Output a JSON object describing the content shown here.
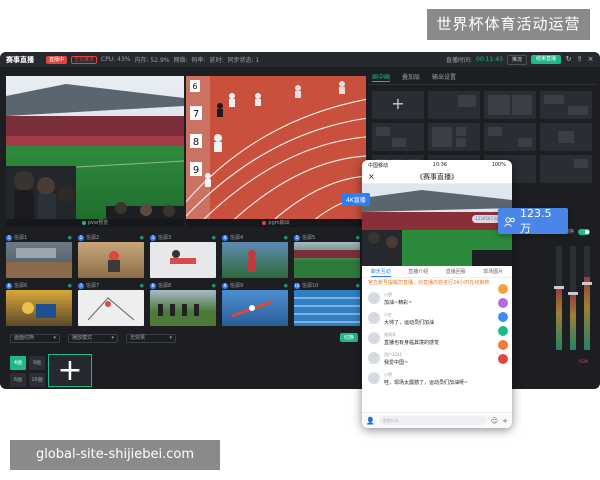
{
  "overlay": {
    "top_banner": "世界杯体育活动运营",
    "bottom_banner": "global-site-shijiebei.com"
  },
  "app": {
    "title": "赛事直播",
    "live_badge": "直播中",
    "rec_badge": "正在推流",
    "stats": [
      "CPU: 43%",
      "内存: 52.9%",
      "网络:",
      "码率:",
      "延时:",
      "同步状态: 1"
    ],
    "duration_label": "直播时间:",
    "duration": "00:11:43",
    "ghost_button": "推流",
    "start_button": "结束直播",
    "preview_caption": "pvw预览",
    "program_caption": "pgm输出"
  },
  "thumbnails": {
    "row1": [
      {
        "num": "1",
        "label": "信源1"
      },
      {
        "num": "2",
        "label": "信源2"
      },
      {
        "num": "3",
        "label": "信源3"
      },
      {
        "num": "4",
        "label": "信源4"
      },
      {
        "num": "5",
        "label": "信源5"
      }
    ],
    "row2": [
      {
        "num": "6",
        "label": "信源6"
      },
      {
        "num": "7",
        "label": "信源7"
      },
      {
        "num": "8",
        "label": "信源8"
      },
      {
        "num": "9",
        "label": "信源9"
      },
      {
        "num": "10",
        "label": "信源10"
      }
    ]
  },
  "selects": [
    "画面切换",
    "播放模式",
    "无效果"
  ],
  "confirm_button": "切换",
  "layout_tiles": [
    "4画",
    "9画",
    "6画",
    "16画"
  ],
  "right_panel": {
    "tabs": [
      "画中画",
      "叠加层",
      "输出设置"
    ],
    "audio_sync_label": "音频同步切换",
    "meter_label": "PGM"
  },
  "phone": {
    "carrier": "中国移动",
    "time": "10:36",
    "battery": "100%",
    "title": "《赛事直播》",
    "badge_4k": "4K直播",
    "viewer_pill": "1234567人在看",
    "chat_tabs": [
      "聊天互动",
      "直播介绍",
      "直播回看",
      "现场图片"
    ],
    "notice": "官方账号提醒您直播，对直播内容进行24小时在线审核",
    "messages": [
      {
        "name": "小明",
        "text": "加油~精彩~"
      },
      {
        "name": "小红",
        "text": "大帅了，运动员们加油"
      },
      {
        "name": "张同学",
        "text": "直播也有身临其境的感觉"
      },
      {
        "name": "用户3241",
        "text": "我爱中国~"
      },
      {
        "name": "小明",
        "text": "哇，现场太震撼了，运动员们加油呀~"
      }
    ],
    "input_placeholder": "说些什么"
  },
  "viewers": {
    "count": "123.5万"
  },
  "colors": {
    "accent": "#1fb889",
    "brand_blue": "#2d7df6",
    "live_red": "#e0443e"
  }
}
